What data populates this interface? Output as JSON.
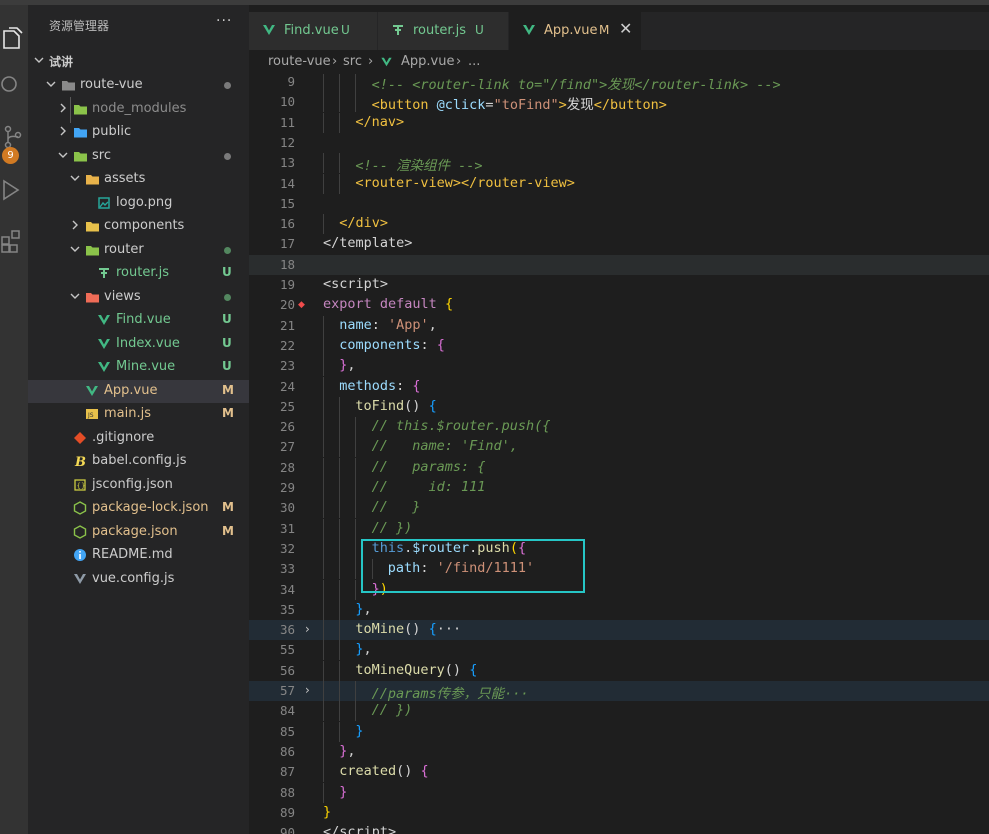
{
  "sidebar": {
    "title": "资源管理器",
    "more": "···",
    "workspace": "试讲",
    "tree": [
      {
        "label": "route-vue",
        "status": "",
        "dot": "#7a7a7a",
        "icon": "folder-icon"
      },
      {
        "label": "node_modules",
        "status": "",
        "dot": "",
        "icon": "folder-icon"
      },
      {
        "label": "public",
        "status": "",
        "dot": "",
        "icon": "folder-icon"
      },
      {
        "label": "src",
        "status": "",
        "dot": "#7a7a7a",
        "icon": "folder-icon"
      },
      {
        "label": "assets",
        "status": "",
        "dot": "",
        "icon": "folder-icon"
      },
      {
        "label": "logo.png",
        "status": "",
        "dot": "",
        "icon": "image-file-icon"
      },
      {
        "label": "components",
        "status": "",
        "dot": "",
        "icon": "folder-icon"
      },
      {
        "label": "router",
        "status": "",
        "dot": "#53875f",
        "icon": "folder-icon"
      },
      {
        "label": "router.js",
        "status": "U",
        "dot": "",
        "icon": "router-file-icon"
      },
      {
        "label": "views",
        "status": "",
        "dot": "#53875f",
        "icon": "folder-icon"
      },
      {
        "label": "Find.vue",
        "status": "U",
        "dot": "",
        "icon": "vue-file-icon"
      },
      {
        "label": "Index.vue",
        "status": "U",
        "dot": "",
        "icon": "vue-file-icon"
      },
      {
        "label": "Mine.vue",
        "status": "U",
        "dot": "",
        "icon": "vue-file-icon"
      },
      {
        "label": "App.vue",
        "status": "M",
        "dot": "",
        "icon": "vue-file-icon"
      },
      {
        "label": "main.js",
        "status": "M",
        "dot": "",
        "icon": "js-file-icon"
      },
      {
        "label": ".gitignore",
        "status": "",
        "dot": "",
        "icon": "git-file-icon"
      },
      {
        "label": "babel.config.js",
        "status": "",
        "dot": "",
        "icon": "babel-file-icon"
      },
      {
        "label": "jsconfig.json",
        "status": "",
        "dot": "",
        "icon": "json-file-icon"
      },
      {
        "label": "package-lock.json",
        "status": "M",
        "dot": "",
        "icon": "node-file-icon"
      },
      {
        "label": "package.json",
        "status": "M",
        "dot": "",
        "icon": "node-file-icon"
      },
      {
        "label": "README.md",
        "status": "",
        "dot": "",
        "icon": "info-file-icon"
      },
      {
        "label": "vue.config.js",
        "status": "",
        "dot": "",
        "icon": "vue-config-file-icon"
      }
    ]
  },
  "activity": {
    "badge": "9"
  },
  "tabs": [
    {
      "label": "Find.vue",
      "status": "U"
    },
    {
      "label": "router.js",
      "status": "U"
    },
    {
      "label": "App.vue",
      "status": "M",
      "close": "✕"
    }
  ],
  "breadcrumb": [
    "route-vue",
    "src",
    "App.vue",
    "..."
  ],
  "colors": {
    "untracked": "#73c991",
    "modified": "#e2c08d",
    "vue": "#41b883",
    "accent": "#26c6c6"
  },
  "editor": {
    "lines": [
      {
        "n": "9",
        "html": "<span class='c-comment'>&lt;!-- &lt;router-link to=\"/find\"&gt;发现&lt;/router-link&gt; --&gt;</span>",
        "indent": 6
      },
      {
        "n": "10",
        "html": "<span class='c-tag'>&lt;button</span> <span class='c-attr'>@click</span>=<span class='c-str'>\"toFind\"</span><span class='c-tag'>&gt;</span>发现<span class='c-tag'>&lt;/button&gt;</span>",
        "indent": 6
      },
      {
        "n": "11",
        "html": "<span class='c-tag'>&lt;/nav&gt;</span>",
        "indent": 4
      },
      {
        "n": "12",
        "html": "",
        "indent": 0
      },
      {
        "n": "13",
        "html": "<span class='c-comment'>&lt;!-- 渲染组件 --&gt;</span>",
        "indent": 4
      },
      {
        "n": "14",
        "html": "<span class='c-tag'>&lt;router-view&gt;&lt;/router-view&gt;</span>",
        "indent": 4
      },
      {
        "n": "15",
        "html": "",
        "indent": 0
      },
      {
        "n": "16",
        "html": "<span class='c-tag'>&lt;/div&gt;</span>",
        "indent": 2
      },
      {
        "n": "17",
        "html": "&lt;/template&gt;",
        "indent": 0
      },
      {
        "n": "18",
        "html": "",
        "indent": 0,
        "hl": true
      },
      {
        "n": "19",
        "html": "&lt;script&gt;",
        "indent": 0
      },
      {
        "n": "20",
        "html": "<span class='c-kw'>export default</span> <span class='c-brace'>{</span>",
        "indent": 0,
        "err": true
      },
      {
        "n": "21",
        "html": "<span class='c-key'>name</span>: <span class='c-str'>'App'</span>,",
        "indent": 2
      },
      {
        "n": "22",
        "html": "<span class='c-key'>components</span>: <span class='c-brace2'>{</span>",
        "indent": 2
      },
      {
        "n": "23",
        "html": "<span class='c-brace2'>}</span>,",
        "indent": 2
      },
      {
        "n": "24",
        "html": "<span class='c-key'>methods</span>: <span class='c-brace2'>{</span>",
        "indent": 2
      },
      {
        "n": "25",
        "html": "<span class='c-fn'>toFind</span>() <span class='c-brace3'>{</span>",
        "indent": 4
      },
      {
        "n": "26",
        "html": "<span class='c-comment'>// this.$router.push({</span>",
        "indent": 6
      },
      {
        "n": "27",
        "html": "<span class='c-comment'>//   name: 'Find',</span>",
        "indent": 6
      },
      {
        "n": "28",
        "html": "<span class='c-comment'>//   params: {</span>",
        "indent": 6
      },
      {
        "n": "29",
        "html": "<span class='c-comment'>//     id: 111</span>",
        "indent": 6
      },
      {
        "n": "30",
        "html": "<span class='c-comment'>//   }</span>",
        "indent": 6
      },
      {
        "n": "31",
        "html": "<span class='c-comment'>// })</span>",
        "indent": 6
      },
      {
        "n": "32",
        "html": "<span class='c-this'>this</span>.<span class='c-key'>$router</span>.<span class='c-fn'>push</span><span class='c-brace'>(</span><span class='c-brace2'>{</span>",
        "indent": 6
      },
      {
        "n": "33",
        "html": "<span class='c-key'>path</span>: <span class='c-str'>'/find/1111'</span>",
        "indent": 8
      },
      {
        "n": "34",
        "html": "<span class='c-brace2'>}</span><span class='c-brace'>)</span>",
        "indent": 6
      },
      {
        "n": "35",
        "html": "<span class='c-brace3'>}</span>,",
        "indent": 4
      },
      {
        "n": "36",
        "html": "<span class='c-fn'>toMine</span>() <span class='c-brace3'>{</span>···",
        "indent": 4,
        "fold": true,
        "hl2": true
      },
      {
        "n": "55",
        "html": "<span class='c-brace3'>}</span>,",
        "indent": 4
      },
      {
        "n": "56",
        "html": "<span class='c-fn'>toMineQuery</span>() <span class='c-brace3'>{</span>",
        "indent": 4
      },
      {
        "n": "57",
        "html": "<span class='c-comment'>//params传参，只能···</span>",
        "indent": 6,
        "fold": true,
        "hl2": true
      },
      {
        "n": "84",
        "html": "<span class='c-comment'>// })</span>",
        "indent": 6
      },
      {
        "n": "85",
        "html": "<span class='c-brace3'>}</span>",
        "indent": 4
      },
      {
        "n": "86",
        "html": "<span class='c-brace2'>}</span>,",
        "indent": 2
      },
      {
        "n": "87",
        "html": "<span class='c-fn'>created</span>() <span class='c-brace2'>{</span>",
        "indent": 2
      },
      {
        "n": "88",
        "html": "<span class='c-brace2'>}</span>",
        "indent": 2
      },
      {
        "n": "89",
        "html": "<span class='c-brace'>}</span>",
        "indent": 0
      },
      {
        "n": "90",
        "html": "&lt;/script&gt;",
        "indent": 0
      }
    ]
  }
}
